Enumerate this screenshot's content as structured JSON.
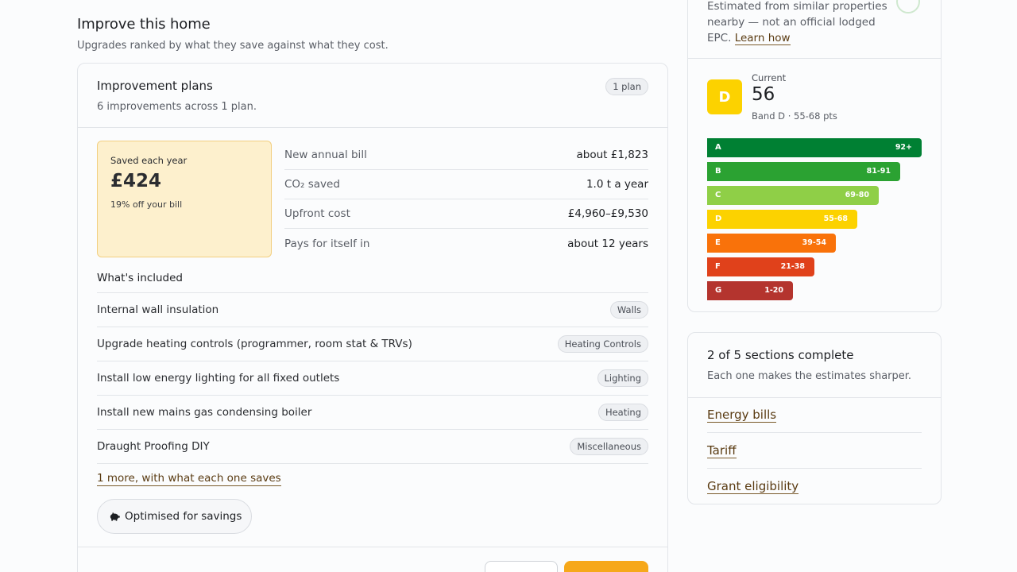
{
  "intro": {
    "title": "Improve this home",
    "subtitle": "Upgrades ranked by what they save against what they cost."
  },
  "plans": {
    "title": "Improvement plans",
    "subtitle": "6 improvements across 1 plan.",
    "count_badge": "1 plan",
    "saved": {
      "label": "Saved each year",
      "value": "£424",
      "note": "19% off your bill"
    },
    "stats": [
      {
        "label": "New annual bill",
        "value": "about £1,823"
      },
      {
        "label": "CO₂ saved",
        "value": "1.0 t a year"
      },
      {
        "label": "Upfront cost",
        "value": "£4,960–£9,530"
      },
      {
        "label": "Pays for itself in",
        "value": "about 12 years"
      }
    ],
    "included_title": "What's included",
    "items": [
      {
        "name": "Internal wall insulation",
        "tag": "Walls"
      },
      {
        "name": "Upgrade heating controls (programmer, room stat & TRVs)",
        "tag": "Heating Controls"
      },
      {
        "name": "Install low energy lighting for all fixed outlets",
        "tag": "Lighting"
      },
      {
        "name": "Install new mains gas condensing boiler",
        "tag": "Heating"
      },
      {
        "name": "Draught Proofing DIY",
        "tag": "Miscellaneous"
      }
    ],
    "more_link": "1 more, with what each one saves",
    "optimised_button": "Optimised for savings",
    "optimised_icon": "piggy-bank-icon"
  },
  "epc": {
    "note": "Estimated from similar properties nearby — not an official lodged EPC.",
    "note_line1": "Estimated from similar properties",
    "note_line2": "nearby — not an official lodged",
    "note_line3": "EPC.",
    "learn_link": "Learn how",
    "rating_letter": "D",
    "current_label": "Current",
    "score": "56",
    "band_text": "Band D · 55-68 pts",
    "bands": [
      {
        "letter": "A",
        "range": "92+",
        "color": "#008033",
        "width": 270
      },
      {
        "letter": "B",
        "range": "81-91",
        "color": "#2ba232",
        "width": 243
      },
      {
        "letter": "C",
        "range": "69-80",
        "color": "#8fcf47",
        "width": 216
      },
      {
        "letter": "D",
        "range": "55-68",
        "color": "#fcd200",
        "width": 189
      },
      {
        "letter": "E",
        "range": "39-54",
        "color": "#f9720a",
        "width": 162
      },
      {
        "letter": "F",
        "range": "21-38",
        "color": "#e0411b",
        "width": 135
      },
      {
        "letter": "G",
        "range": "1-20",
        "color": "#b4342e",
        "width": 108
      }
    ]
  },
  "sections": {
    "title": "2 of 5 sections complete",
    "subtitle": "Each one makes the estimates sharper.",
    "links": [
      "Energy bills",
      "Tariff",
      "Grant eligibility"
    ]
  }
}
